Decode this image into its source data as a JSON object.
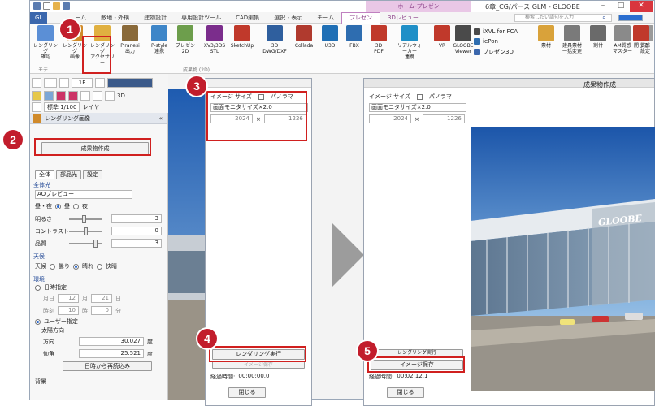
{
  "window": {
    "title": "6章_CG/パース.GLM - GLOOBE",
    "context_tab": "ホーム-プレゼン"
  },
  "tabs": [
    "GL",
    "ーム",
    "敷地・外構",
    "建物設計",
    "専用設計ツール",
    "CAD編集",
    "選択・表示",
    "チーム",
    "プレゼン",
    "3Dレビュー"
  ],
  "search_placeholder": "検索したい語句を入力",
  "ribbon": {
    "buttons": [
      {
        "label": "レンダリング\n確認",
        "color": "#5b8fd6"
      },
      {
        "label": "レンダリング\n画像",
        "color": "#d08a2a"
      },
      {
        "label": "レンダリング\nアクセサリー",
        "color": "#e0b040"
      },
      {
        "label": "Piranesi\n出力",
        "color": "#8a6a3a"
      },
      {
        "label": "P-style\n連携",
        "color": "#3e86c8"
      },
      {
        "label": "プレゼン\n2D",
        "color": "#6d9e4c"
      },
      {
        "label": "XV3/3DS\nSTL",
        "color": "#7b2d8c"
      },
      {
        "label": "SketchUp",
        "color": "#c0392b"
      },
      {
        "label": "3D\nDWG/DXF",
        "color": "#2f5f9e"
      },
      {
        "label": "Collada",
        "color": "#b03a2e"
      },
      {
        "label": "U3D",
        "color": "#1f6fb5"
      },
      {
        "label": "FBX",
        "color": "#2e6db0"
      },
      {
        "label": "3D\nPDF",
        "color": "#c0392b"
      },
      {
        "label": "リアルウォーカー\n連携",
        "color": "#1f8fc7"
      },
      {
        "label": "VR",
        "color": "#c0392b"
      },
      {
        "label": "GLOOBE\nViewer",
        "color": "#4a4a4a"
      }
    ],
    "small_items": [
      "iXVL for FCA",
      "iePon",
      "プレゼン3D"
    ],
    "right_buttons": [
      {
        "label": "素材",
        "color": "#d9a23a"
      },
      {
        "label": "建具素材\n一括変更",
        "color": "#7a7a7a"
      },
      {
        "label": "割付",
        "color": "#6a6a6a"
      },
      {
        "label": "AM質感\nマスター",
        "color": "#8a8a8a"
      },
      {
        "label": "質感\n設定",
        "color": "#9a9a9a"
      },
      {
        "label": "閉じる",
        "color": "#c0392b"
      }
    ],
    "group_labels": [
      "モデ",
      "成果物 (2D)"
    ]
  },
  "toolbar": {
    "floor": "1F",
    "view3d": "3D",
    "scale": "標準 1/100",
    "layer": "レイヤ"
  },
  "panel": {
    "header": "レンダリング画像",
    "create_button": "成果物作成",
    "subtabs": [
      "全体",
      "部品光",
      "設定"
    ],
    "section_all_light": "全体光",
    "preset": "AOプレビュー",
    "day_night": {
      "label": "昼・夜",
      "day": "昼",
      "night": "夜"
    },
    "brightness": {
      "label": "明るさ",
      "value": "3"
    },
    "contrast": {
      "label": "コントラスト",
      "value": "0"
    },
    "quality": {
      "label": "品質",
      "value": "3"
    },
    "section_weather": "天候",
    "weather": {
      "label": "天候",
      "options": [
        "曇り",
        "晴れ",
        "快晴"
      ]
    },
    "section_env": "環境",
    "date_mode": "日時指定",
    "date": {
      "label": "月日",
      "month": "12",
      "month_unit": "月",
      "day": "21",
      "day_unit": "日"
    },
    "time": {
      "label": "時刻",
      "hour": "10",
      "hour_unit": "時",
      "minute": "0",
      "minute_unit": "分"
    },
    "user_mode": "ユーザー指定",
    "sun_dir": "太陽方向",
    "azimuth": {
      "label": "方向",
      "value": "30.027",
      "unit": "度"
    },
    "elevation": {
      "label": "仰角",
      "value": "25.521",
      "unit": "度"
    },
    "reread_button": "日時から再読込み",
    "background": "背景"
  },
  "dialog1": {
    "image_size_label": "イメージ サイズ",
    "panorama_label": "パノラマ",
    "size_select": "画面モニタサイズ×2.0",
    "width": "2024",
    "times": "×",
    "height": "1226",
    "render_button": "レンダリング実行",
    "save_button_disabled": "イメージ保存",
    "elapsed_label": "経過時間:",
    "elapsed_value": "00:00:00.0",
    "close_button": "閉じる"
  },
  "dialog2": {
    "title": "成果物作成",
    "image_size_label": "イメージ サイズ",
    "panorama_label": "パノラマ",
    "size_select": "画面モニタサイズ×2.0",
    "width": "2024",
    "times": "×",
    "height": "1226",
    "render_button": "レンダリング実行",
    "save_button": "イメージ保存",
    "elapsed_label": "経過時間:",
    "elapsed_value": "00:02:12.1",
    "close_button": "閉じる",
    "building_sign": "GLOOBE"
  },
  "steps": [
    "1",
    "2",
    "3",
    "4",
    "5"
  ]
}
